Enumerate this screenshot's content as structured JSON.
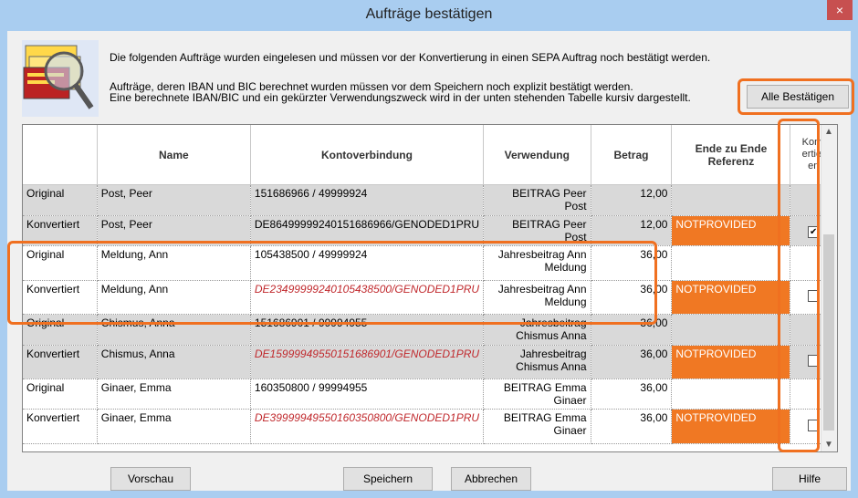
{
  "window": {
    "title": "Aufträge bestätigen",
    "close_label": "×"
  },
  "info": {
    "line1": "Die folgenden Aufträge wurden eingelesen und müssen vor der Konvertierung in einen SEPA Auftrag noch bestätigt werden.",
    "line2": "Aufträge, deren IBAN und BIC berechnet wurden müssen vor dem Speichern noch explizit bestätigt werden.",
    "line3": "Eine berechnete IBAN/BIC und ein gekürzter Verwendungszweck wird in der unten stehenden Tabelle kursiv dargestellt."
  },
  "buttons": {
    "alle_bestaetigen": "Alle Bestätigen",
    "vorschau": "Vorschau",
    "speichern": "Speichern",
    "abbrechen": "Abbrechen",
    "hilfe": "Hilfe"
  },
  "table": {
    "headers": [
      "",
      "Name",
      "Kontoverbindung",
      "Verwendung",
      "Betrag",
      "Ende zu Ende Referenz",
      "Konvertieren"
    ],
    "rows": [
      {
        "typ": "Original",
        "name": "Post, Peer",
        "konto": "151686966 / 49999924",
        "verw": "BEITRAG Peer Post",
        "betrag": "12,00",
        "ref": "",
        "conv": ""
      },
      {
        "typ": "Konvertiert",
        "name": "Post, Peer",
        "konto": "DE86499999240151686966/GENODED1PRU",
        "verw": "BEITRAG Peer Post",
        "betrag": "12,00",
        "ref": "NOTPROVIDED",
        "conv": "✔"
      },
      {
        "typ": "Original",
        "name": "Meldung, Ann",
        "konto": "105438500 / 49999924",
        "verw": "Jahresbeitrag Ann Meldung",
        "betrag": "36,00",
        "ref": "",
        "conv": ""
      },
      {
        "typ": "Konvertiert",
        "name": "Meldung, Ann",
        "konto": "DE23499999240105438500/GENODED1PRU",
        "verw": "Jahresbeitrag Ann Meldung",
        "betrag": "36,00",
        "ref": "NOTPROVIDED",
        "conv": " "
      },
      {
        "typ": "Original",
        "name": "Chismus, Anna",
        "konto": "151686901 / 99994955",
        "verw": "Jahresbeitrag Chismus Anna",
        "betrag": "36,00",
        "ref": "",
        "conv": ""
      },
      {
        "typ": "Konvertiert",
        "name": "Chismus, Anna",
        "konto": "DE15999949550151686901/GENODED1PRU",
        "verw": "Jahresbeitrag Chismus Anna",
        "betrag": "36,00",
        "ref": "NOTPROVIDED",
        "conv": " "
      },
      {
        "typ": "Original",
        "name": "Ginaer, Emma",
        "konto": "160350800 / 99994955",
        "verw": "BEITRAG Emma Ginaer",
        "betrag": "36,00",
        "ref": "",
        "conv": ""
      },
      {
        "typ": "Konvertiert",
        "name": "Ginaer, Emma",
        "konto": "DE39999949550160350800/GENODED1PRU",
        "verw": "BEITRAG Emma Ginaer",
        "betrag": "36,00",
        "ref": "NOTPROVIDED",
        "conv": " "
      }
    ]
  },
  "colors": {
    "accent_orange": "#f07823",
    "red_text": "#c0282c"
  }
}
